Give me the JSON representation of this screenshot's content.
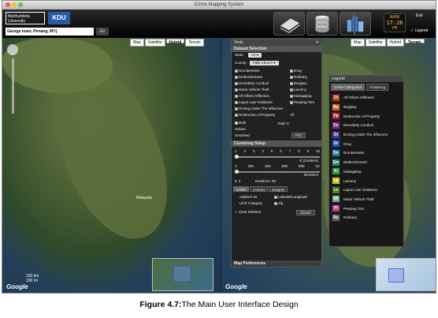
{
  "window": {
    "title": "Crime Mapping System"
  },
  "header": {
    "logo_left": "Northumbria University",
    "logo_right": "KDU",
    "search_value": "George town, Penang, MY(",
    "go_label": "Go",
    "tool_icons": [
      "document-pages-icon",
      "database-icon",
      "city-buildings-icon",
      "gear-wrench-icon"
    ],
    "clock_line1": "WARN",
    "clock_time": "17:26",
    "clock_line3": "PM",
    "exit_label": "Exit",
    "legend_toggle_label": "Legend"
  },
  "map_left": {
    "buttons": [
      {
        "label": "Map",
        "selected": false
      },
      {
        "label": "Satellite",
        "selected": false
      },
      {
        "label": "Hybrid",
        "selected": true
      },
      {
        "label": "Terrain",
        "selected": false
      }
    ],
    "scale_km": "100 km",
    "scale_mi": "100 mi",
    "google_label": "Google",
    "region_label": "Malaysia"
  },
  "map_right": {
    "buttons": [
      {
        "label": "Map",
        "selected": false
      },
      {
        "label": "Satellite",
        "selected": false
      },
      {
        "label": "Hybrid",
        "selected": false
      },
      {
        "label": "Terrain",
        "selected": true
      }
    ],
    "google_label": "Google"
  },
  "tools": {
    "title": "Tools",
    "dataset_header": "Dataset Selection",
    "state_label": "State:",
    "state_value": "VA",
    "county_label": "County:",
    "county_value": "Falls Church",
    "crimes_left": [
      "Drunkenness",
      "Embezzlement",
      "Disorderly Conduct",
      "Motor Vehicle Theft",
      "All Others Offenses",
      "Liquor Law Violations",
      "Driving Under The Influence",
      "Destruction of Property"
    ],
    "crimes_right": [
      "Drug",
      "Robbery",
      "Burglary",
      "Larceny",
      "Kidnapping",
      "Peeping Tom",
      "",
      "All"
    ],
    "radio_both": "Both",
    "radio_solved": "Solved",
    "radio_unsolved": "Unsolved",
    "total_label": "Total:",
    "total_value": "0",
    "plot_label": "Plot",
    "clustering_header": "Clustering Setup",
    "k_ticks": [
      "1",
      "2",
      "3",
      "4",
      "5",
      "6",
      "7",
      "8",
      "9",
      "10"
    ],
    "k_label": "K (Clusters)",
    "iter_ticks": [
      "1",
      "200",
      "400",
      "600",
      "800",
      "1K"
    ],
    "iter_label": "Iterations",
    "k_value": "k: 0",
    "iter_value": "Iterations: 50",
    "tabs": [
      "Crime",
      "Convict",
      "Suspect"
    ],
    "opt_address": "Address ID",
    "opt_latlong": "Latitude/Longitude",
    "opt_ucr": "UCR Category",
    "opt_zip": "Zip",
    "clear_markers": "Clear Markers",
    "cluster_label": "Cluster",
    "map_prefs": "Map Preferences"
  },
  "legend": {
    "title": "Legend",
    "tabs": [
      "Crime Categories",
      "Clustering"
    ],
    "items": [
      {
        "code": "Ot",
        "label": "All Others Offenses",
        "color": "#c0341e"
      },
      {
        "code": "Bu",
        "label": "Burglary",
        "color": "#d65a12"
      },
      {
        "code": "Dp",
        "label": "Destruction of Property",
        "color": "#b0213a"
      },
      {
        "code": "Dc",
        "label": "Disorderly Conduct",
        "color": "#7a2a8c"
      },
      {
        "code": "Di",
        "label": "Driving Under The Influence",
        "color": "#4a3aa5"
      },
      {
        "code": "Dr",
        "label": "Drug",
        "color": "#2356b8"
      },
      {
        "code": "Dn",
        "label": "Drunkenness",
        "color": "#1c7bb0"
      },
      {
        "code": "Em",
        "label": "Embezzlement",
        "color": "#198a6a"
      },
      {
        "code": "Ki",
        "label": "Kidnapping",
        "color": "#2e9a2c"
      },
      {
        "code": "La",
        "label": "Larceny",
        "color": "#d2c21a"
      },
      {
        "code": "Lv",
        "label": "Liquor Law Violations",
        "color": "#4a7a1c"
      },
      {
        "code": "Mt",
        "label": "Motor Vehicle Theft",
        "color": "#8a9aa0"
      },
      {
        "code": "Pt",
        "label": "Peeping Tom",
        "color": "#b83a8a"
      },
      {
        "code": "Ro",
        "label": "Robbery",
        "color": "#606060"
      }
    ]
  },
  "caption": {
    "prefix": "Figure 4.7:",
    "text": "The Main User Interface Design"
  }
}
